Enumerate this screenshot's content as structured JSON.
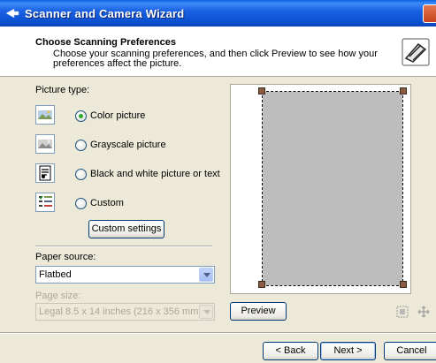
{
  "window": {
    "title": "Scanner and Camera Wizard"
  },
  "header": {
    "title": "Choose Scanning Preferences",
    "subtitle": "Choose your scanning preferences, and then click Preview to see how your preferences affect the picture."
  },
  "picture_type": {
    "label": "Picture type:",
    "options": [
      {
        "label": "Color picture",
        "checked": true,
        "icon": "color-picture-icon"
      },
      {
        "label": "Grayscale picture",
        "checked": false,
        "icon": "grayscale-picture-icon"
      },
      {
        "label": "Black and white picture or text",
        "checked": false,
        "icon": "bw-picture-icon"
      },
      {
        "label": "Custom",
        "checked": false,
        "icon": "custom-settings-icon"
      }
    ],
    "custom_settings_button": "Custom settings"
  },
  "paper_source": {
    "label": "Paper source:",
    "value": "Flatbed"
  },
  "page_size": {
    "label": "Page size:",
    "value": "Legal 8.5 x 14 inches (216 x 356 mm)",
    "disabled": true
  },
  "preview": {
    "button": "Preview",
    "zoom_icon": "zoom-to-selection-icon",
    "fit_icon": "fit-to-page-icon"
  },
  "footer": {
    "back": "< Back",
    "next": "Next >",
    "cancel": "Cancel"
  },
  "colors": {
    "title_bar": "#0A4FCF",
    "window_bg": "#ECE9D8",
    "handle": "#8B5A43",
    "page_gray": "#BDBDBD"
  }
}
